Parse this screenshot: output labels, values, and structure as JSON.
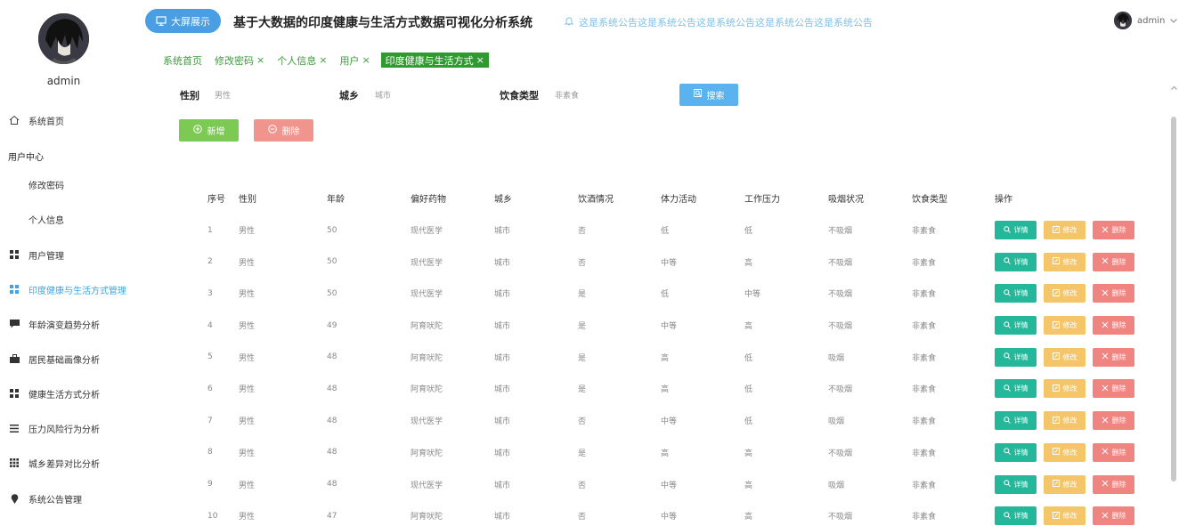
{
  "sidebar": {
    "username": "admin",
    "items": [
      {
        "label": "系统首页",
        "icon": "home-icon"
      },
      {
        "label": "用户中心",
        "type": "group"
      },
      {
        "label": "修改密码",
        "type": "sub"
      },
      {
        "label": "个人信息",
        "type": "sub"
      },
      {
        "label": "用户管理",
        "icon": "grid-icon"
      },
      {
        "label": "印度健康与生活方式管理",
        "icon": "grid-icon",
        "active": true
      },
      {
        "label": "年龄演变趋势分析",
        "icon": "chat-icon"
      },
      {
        "label": "居民基础画像分析",
        "icon": "briefcase-icon"
      },
      {
        "label": "健康生活方式分析",
        "icon": "grid-icon"
      },
      {
        "label": "压力风险行为分析",
        "icon": "list-icon"
      },
      {
        "label": "城乡差异对比分析",
        "icon": "grid9-icon"
      },
      {
        "label": "系统公告管理",
        "icon": "location-icon"
      }
    ]
  },
  "header": {
    "big_screen_label": "大屏展示",
    "title": "基于大数据的印度健康与生活方式数据可视化分析系统",
    "notice": "这是系统公告这是系统公告这是系统公告这是系统公告这是系统公告",
    "user": "admin"
  },
  "tabs": [
    {
      "label": "系统首页",
      "closable": false
    },
    {
      "label": "修改密码",
      "closable": true
    },
    {
      "label": "个人信息",
      "closable": true
    },
    {
      "label": "用户",
      "closable": true
    },
    {
      "label": "印度健康与生活方式",
      "closable": true,
      "active": true
    }
  ],
  "search": {
    "gender_label": "性别",
    "gender_value": "男性",
    "region_label": "城乡",
    "region_value": "城市",
    "diet_label": "饮食类型",
    "diet_value": "非素食",
    "search_button": "搜索"
  },
  "actions": {
    "add": "新增",
    "delete": "删除"
  },
  "table": {
    "headers": [
      "序号",
      "性别",
      "年龄",
      "偏好药物",
      "城乡",
      "饮酒情况",
      "体力活动",
      "工作压力",
      "吸烟状况",
      "饮食类型",
      "操作"
    ],
    "op_labels": {
      "detail": "详情",
      "edit": "修改",
      "delete": "删除"
    },
    "rows": [
      [
        "1",
        "男性",
        "50",
        "现代医学",
        "城市",
        "否",
        "低",
        "低",
        "不吸烟",
        "非素食"
      ],
      [
        "2",
        "男性",
        "50",
        "现代医学",
        "城市",
        "否",
        "中等",
        "高",
        "不吸烟",
        "非素食"
      ],
      [
        "3",
        "男性",
        "50",
        "现代医学",
        "城市",
        "是",
        "低",
        "中等",
        "不吸烟",
        "非素食"
      ],
      [
        "4",
        "男性",
        "49",
        "阿育吠陀",
        "城市",
        "是",
        "中等",
        "高",
        "不吸烟",
        "非素食"
      ],
      [
        "5",
        "男性",
        "48",
        "阿育吠陀",
        "城市",
        "是",
        "高",
        "低",
        "吸烟",
        "非素食"
      ],
      [
        "6",
        "男性",
        "48",
        "阿育吠陀",
        "城市",
        "是",
        "高",
        "低",
        "不吸烟",
        "非素食"
      ],
      [
        "7",
        "男性",
        "48",
        "现代医学",
        "城市",
        "否",
        "中等",
        "低",
        "吸烟",
        "非素食"
      ],
      [
        "8",
        "男性",
        "48",
        "阿育吠陀",
        "城市",
        "是",
        "高",
        "高",
        "不吸烟",
        "非素食"
      ],
      [
        "9",
        "男性",
        "48",
        "现代医学",
        "城市",
        "否",
        "中等",
        "高",
        "吸烟",
        "非素食"
      ],
      [
        "10",
        "男性",
        "47",
        "阿育吠陀",
        "城市",
        "否",
        "中等",
        "高",
        "不吸烟",
        "非素食"
      ]
    ]
  },
  "colors": {
    "accent": "#4a9ee3",
    "tab_active": "#2f9a2f",
    "detail": "#25b79a",
    "edit": "#f5c56a",
    "delete": "#f08480",
    "add": "#7cc954"
  }
}
